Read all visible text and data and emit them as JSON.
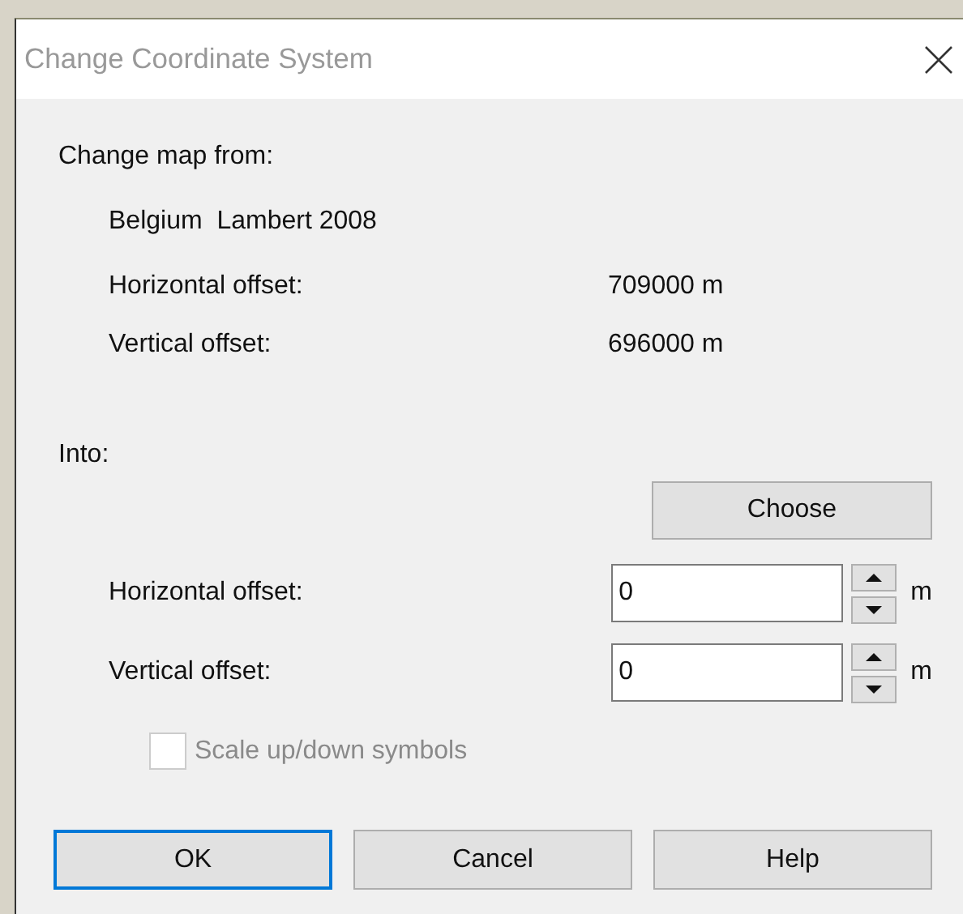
{
  "window": {
    "title": "Change Coordinate System"
  },
  "source": {
    "heading": "Change map from:",
    "system": "Belgium  Lambert 2008",
    "rows": [
      {
        "label": "Horizontal offset:",
        "value": "709000 m"
      },
      {
        "label": "Vertical offset:",
        "value": "696000 m"
      }
    ]
  },
  "target": {
    "heading": "Into:",
    "choose_button": "Choose",
    "fields": [
      {
        "label": "Horizontal offset:",
        "value": "0",
        "unit": "m"
      },
      {
        "label": "Vertical offset:",
        "value": "0",
        "unit": "m"
      }
    ]
  },
  "scale_checkbox": {
    "label": "Scale up/down symbols",
    "checked": false,
    "disabled": true
  },
  "buttons": [
    {
      "label": "OK",
      "default": true
    },
    {
      "label": "Cancel",
      "default": false
    },
    {
      "label": "Help",
      "default": false
    }
  ]
}
